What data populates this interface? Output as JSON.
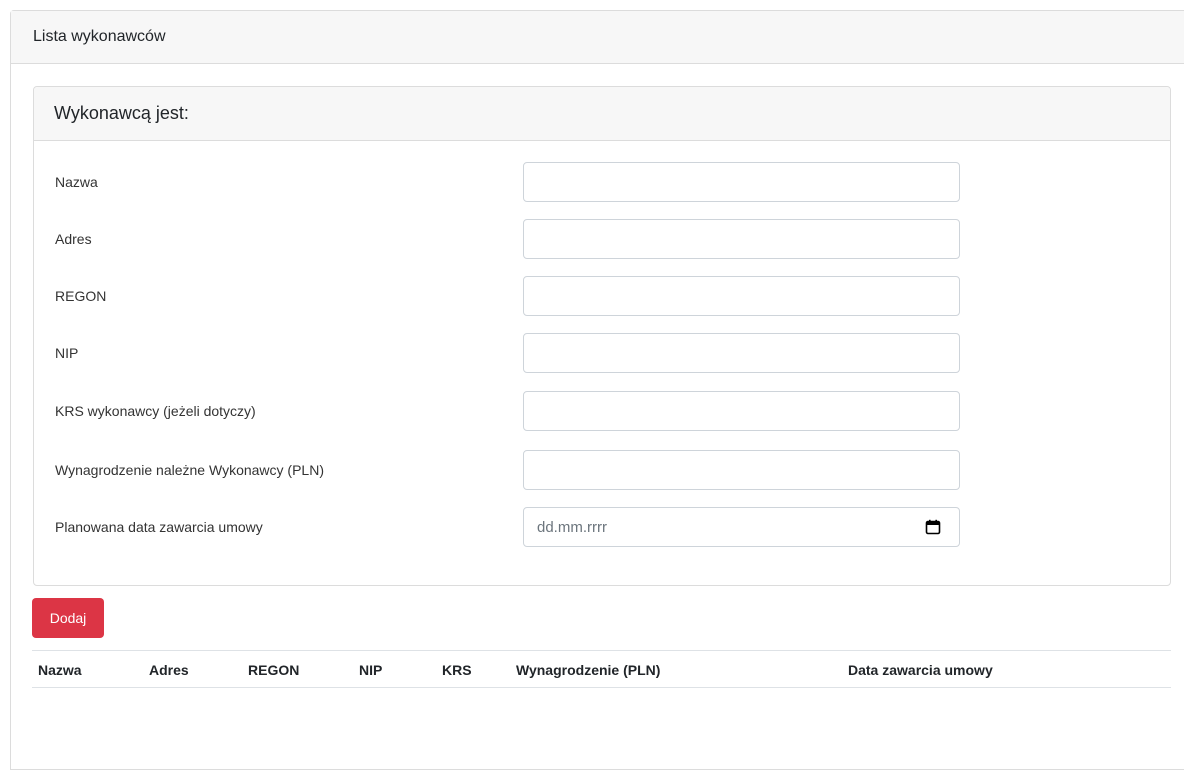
{
  "outer_card": {
    "title": "Lista wykonawców"
  },
  "inner_card": {
    "title": "Wykonawcą jest:"
  },
  "form": {
    "fields": [
      {
        "label": "Nazwa",
        "value": "",
        "placeholder": ""
      },
      {
        "label": "Adres",
        "value": "",
        "placeholder": ""
      },
      {
        "label": "REGON",
        "value": "",
        "placeholder": ""
      },
      {
        "label": "NIP",
        "value": "",
        "placeholder": ""
      },
      {
        "label": "KRS wykonawcy (jeżeli dotyczy)",
        "value": "",
        "placeholder": ""
      },
      {
        "label": "Wynagrodzenie należne Wykonawcy (PLN)",
        "value": "",
        "placeholder": ""
      },
      {
        "label": "Planowana data zawarcia umowy",
        "value": "",
        "placeholder": "dd.mm.rrrr"
      }
    ]
  },
  "add_button": {
    "label": "Dodaj",
    "color": "#dc3545"
  },
  "table": {
    "columns": [
      "Nazwa",
      "Adres",
      "REGON",
      "NIP",
      "KRS",
      "Wynagrodzenie (PLN)",
      "Data zawarcia umowy"
    ],
    "rows": []
  },
  "icons": {
    "date_picker": "calendar-icon"
  }
}
